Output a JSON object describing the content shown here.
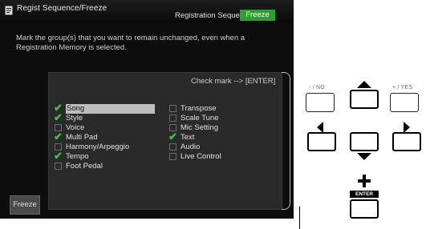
{
  "header": {
    "title": "Regist Sequence/Freeze"
  },
  "tabs": [
    {
      "label": "Registration Sequence",
      "active": false
    },
    {
      "label": "Freeze",
      "active": true
    }
  ],
  "description": "Mark the group(s) that you want to remain unchanged, even when a Registration Memory is selected.",
  "check_hint": "Check mark --> [ENTER]",
  "left_items": [
    {
      "label": "Song",
      "checked": true,
      "selected": true
    },
    {
      "label": "Style",
      "checked": true,
      "selected": false
    },
    {
      "label": "Voice",
      "checked": false,
      "selected": false
    },
    {
      "label": "Multi Pad",
      "checked": true,
      "selected": false
    },
    {
      "label": "Harmony/Arpeggio",
      "checked": false,
      "selected": false
    },
    {
      "label": "Tempo",
      "checked": true,
      "selected": false
    },
    {
      "label": "Foot Pedal",
      "checked": false,
      "selected": false
    }
  ],
  "right_items": [
    {
      "label": "Transpose",
      "checked": false
    },
    {
      "label": "Scale Tune",
      "checked": false
    },
    {
      "label": "Mic Setting",
      "checked": false
    },
    {
      "label": "Text",
      "checked": true
    },
    {
      "label": "Audio",
      "checked": false
    },
    {
      "label": "Live Control",
      "checked": false
    }
  ],
  "freeze_button": "Freeze",
  "panel_buttons": {
    "no": "- / NO",
    "yes": "+ / YES",
    "enter": "ENTER"
  },
  "colors": {
    "accent": "#2ca02c",
    "checkmark": "#3cc43c",
    "screen_bg": "#0d0d0d"
  }
}
